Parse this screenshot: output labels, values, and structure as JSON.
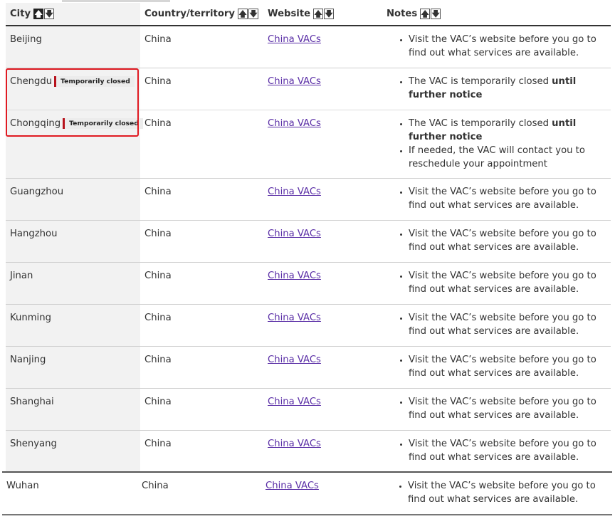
{
  "table": {
    "headers": {
      "city": "City",
      "country": "Country/territory",
      "website": "Website",
      "notes": "Notes"
    },
    "sort_up": "🡅",
    "sort_down": "🡇",
    "status_badge": "Temporarily closed",
    "rows": [
      {
        "city": "Beijing",
        "country": "China",
        "website": "China VACs",
        "notes": [
          "Visit the VAC’s website before you go to find out what services are available."
        ]
      },
      {
        "city": "Chengdu",
        "country": "China",
        "website": "China VACs",
        "closed": true,
        "notes": [
          "The VAC is temporarily closed until further notice"
        ]
      },
      {
        "city": "Chongqing",
        "country": "China",
        "website": "China VACs",
        "closed": true,
        "notes": [
          "The VAC is temporarily closed until further notice",
          "If needed, the VAC will contact you to reschedule your appointment"
        ]
      },
      {
        "city": "Guangzhou",
        "country": "China",
        "website": "China VACs",
        "notes": [
          "Visit the VAC’s website before you go to find out what services are available."
        ]
      },
      {
        "city": "Hangzhou",
        "country": "China",
        "website": "China VACs",
        "notes": [
          "Visit the VAC’s website before you go to find out what services are available."
        ]
      },
      {
        "city": "Jinan",
        "country": "China",
        "website": "China VACs",
        "notes": [
          "Visit the VAC’s website before you go to find out what services are available."
        ]
      },
      {
        "city": "Kunming",
        "country": "China",
        "website": "China VACs",
        "notes": [
          "Visit the VAC’s website before you go to find out what services are available."
        ]
      },
      {
        "city": "Nanjing",
        "country": "China",
        "website": "China VACs",
        "notes": [
          "Visit the VAC’s website before you go to find out what services are available."
        ]
      },
      {
        "city": "Shanghai",
        "country": "China",
        "website": "China VACs",
        "notes": [
          "Visit the VAC’s website before you go to find out what services are available."
        ]
      },
      {
        "city": "Shenyang",
        "country": "China",
        "website": "China VACs",
        "notes": [
          "Visit the VAC’s website before you go to find out what services are available."
        ]
      },
      {
        "city": "Wuhan",
        "country": "China",
        "website": "China VACs",
        "notes": [
          "Visit the VAC’s website before you go to find out what services are available."
        ]
      }
    ],
    "closed_note": {
      "prefix": "The VAC is temporarily closed ",
      "bold": "until further notice"
    }
  },
  "colors": {
    "link": "#5a2ea6",
    "highlight_box": "#e01a22",
    "badge_bar": "#b7121c"
  }
}
